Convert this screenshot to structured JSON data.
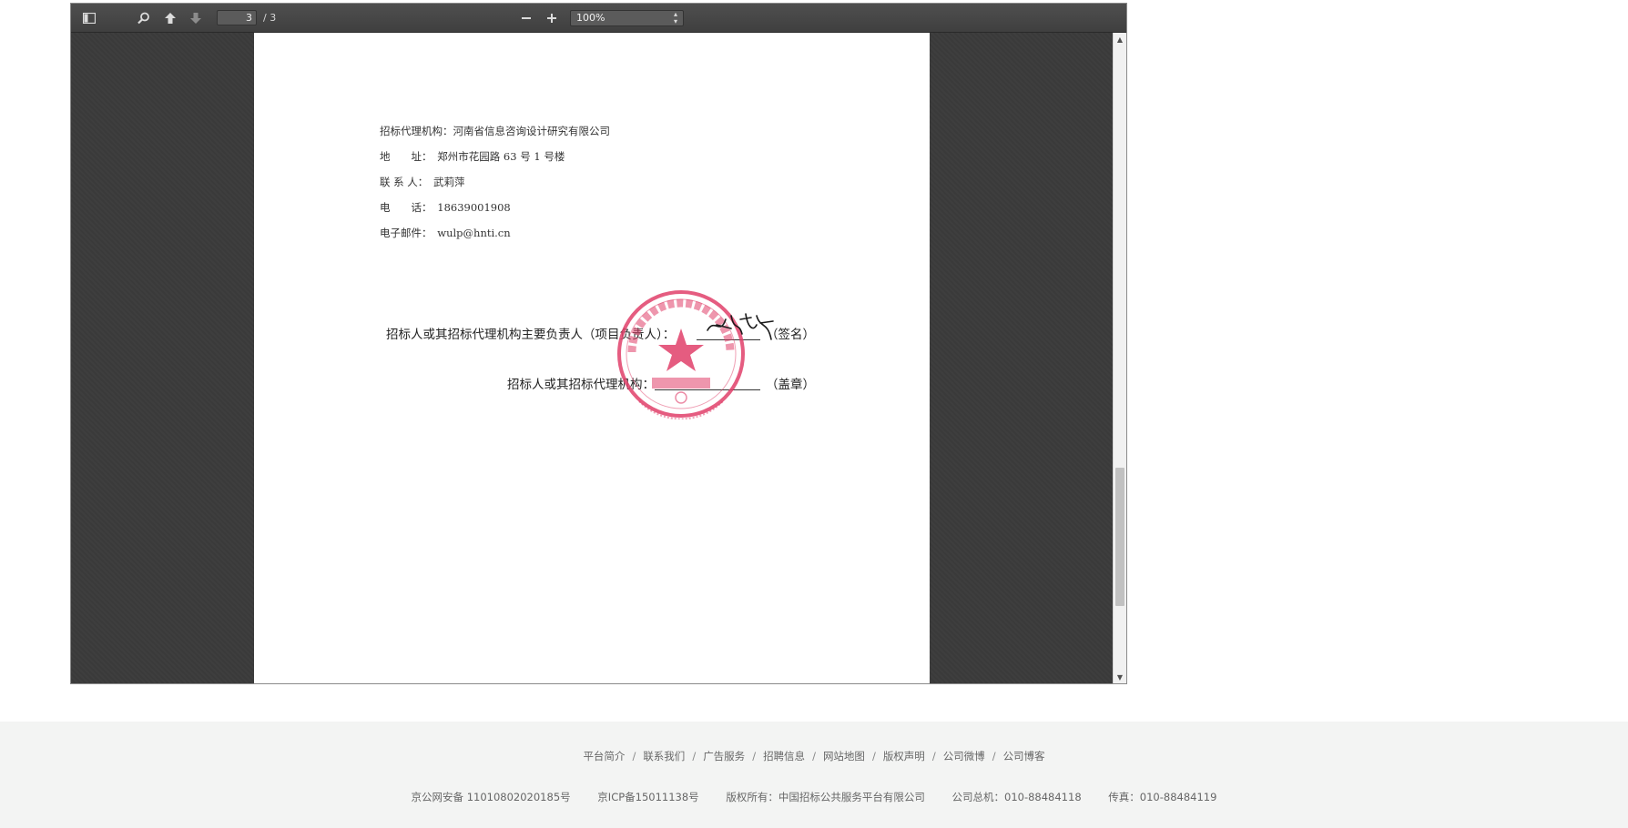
{
  "toolbar": {
    "page_current": "3",
    "page_total": "/ 3",
    "zoom_value": "100%"
  },
  "document": {
    "agency_line": "招标代理机构：河南省信息咨询设计研究有限公司",
    "address_line": "地　　址：　郑州市花园路 63 号 1 号楼",
    "contact_line": "联 系 人：　武莉萍",
    "phone_line": "电　　话：　18639001908",
    "email_line": "电子邮件：　wulp@hnti.cn",
    "signature_line": "招标人或其招标代理机构主要负责人（项目负责人）：",
    "signature_suffix": "（签名）",
    "seal_line": "招标人或其招标代理机构：",
    "seal_suffix": "（盖章）"
  },
  "footer": {
    "links": [
      "平台简介",
      "联系我们",
      "广告服务",
      "招聘信息",
      "网站地图",
      "版权声明",
      "公司微博",
      "公司博客"
    ],
    "separator": "/",
    "police_record": "京公网安备 11010802020185号",
    "icp_record": "京ICP备15011138号",
    "copyright": "版权所有：中国招标公共服务平台有限公司",
    "phone": "公司总机：010-88484118",
    "fax": "传真：010-88484119"
  },
  "colors": {
    "stamp_red": "#e0406a",
    "toolbar_bg": "#474747",
    "viewer_bg": "#3c3c3c",
    "footer_bg": "#f3f4f3"
  },
  "icons": {
    "sidebar_toggle": "sidebar-toggle-icon",
    "search": "search-icon",
    "previous_page": "arrow-up-icon",
    "next_page": "arrow-down-icon",
    "zoom_out": "minus-icon",
    "zoom_in": "plus-icon"
  }
}
